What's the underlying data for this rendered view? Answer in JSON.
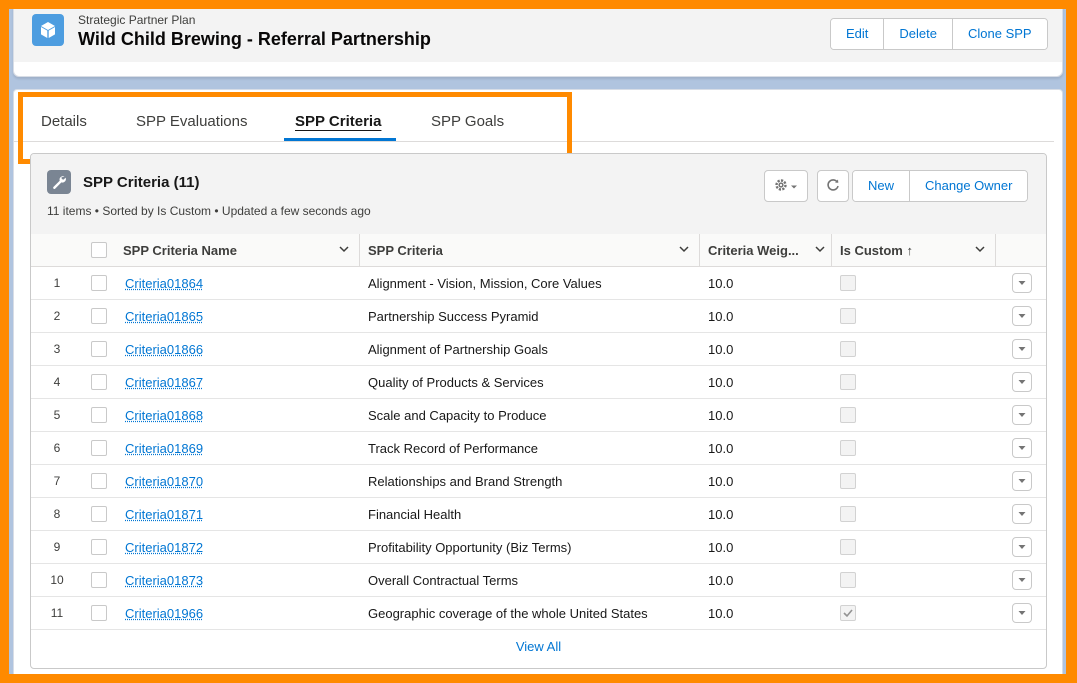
{
  "header": {
    "object_icon": "cube-icon",
    "kicker": "Strategic Partner Plan",
    "title": "Wild Child Brewing - Referral Partnership",
    "actions": [
      "Edit",
      "Delete",
      "Clone SPP"
    ]
  },
  "tabs": [
    {
      "label": "Details",
      "active": false
    },
    {
      "label": "SPP Evaluations",
      "active": false
    },
    {
      "label": "SPP Criteria",
      "active": true
    },
    {
      "label": "SPP Goals",
      "active": false
    }
  ],
  "related_list": {
    "icon": "wrench-icon",
    "title": "SPP Criteria (11)",
    "meta": "11 items • Sorted by Is Custom • Updated a few seconds ago",
    "buttons": [
      "New",
      "Change Owner"
    ],
    "columns": [
      "SPP Criteria Name",
      "SPP Criteria",
      "Criteria Weig...",
      "Is Custom ↑"
    ],
    "rows": [
      {
        "num": "1",
        "name": "Criteria01864",
        "criteria": "Alignment - Vision, Mission, Core Values",
        "weight": "10.0",
        "custom": false
      },
      {
        "num": "2",
        "name": "Criteria01865",
        "criteria": "Partnership Success Pyramid",
        "weight": "10.0",
        "custom": false
      },
      {
        "num": "3",
        "name": "Criteria01866",
        "criteria": "Alignment of Partnership Goals",
        "weight": "10.0",
        "custom": false
      },
      {
        "num": "4",
        "name": "Criteria01867",
        "criteria": "Quality of Products & Services",
        "weight": "10.0",
        "custom": false
      },
      {
        "num": "5",
        "name": "Criteria01868",
        "criteria": "Scale and Capacity to Produce",
        "weight": "10.0",
        "custom": false
      },
      {
        "num": "6",
        "name": "Criteria01869",
        "criteria": "Track Record of Performance",
        "weight": "10.0",
        "custom": false
      },
      {
        "num": "7",
        "name": "Criteria01870",
        "criteria": "Relationships and Brand Strength",
        "weight": "10.0",
        "custom": false
      },
      {
        "num": "8",
        "name": "Criteria01871",
        "criteria": "Financial Health",
        "weight": "10.0",
        "custom": false
      },
      {
        "num": "9",
        "name": "Criteria01872",
        "criteria": "Profitability Opportunity (Biz Terms)",
        "weight": "10.0",
        "custom": false
      },
      {
        "num": "10",
        "name": "Criteria01873",
        "criteria": "Overall Contractual Terms",
        "weight": "10.0",
        "custom": false
      },
      {
        "num": "11",
        "name": "Criteria01966",
        "criteria": "Geographic coverage of the whole United States",
        "weight": "10.0",
        "custom": true
      }
    ],
    "view_all": "View All"
  },
  "colors": {
    "accent": "#0176d3",
    "highlight": "#ff8a00"
  }
}
